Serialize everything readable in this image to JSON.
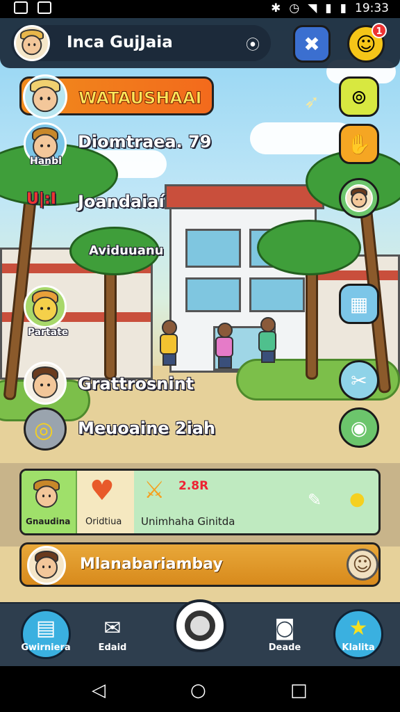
{
  "status_bar": {
    "time": "19:33"
  },
  "header": {
    "player_name": "Inca GujJaia",
    "location_icon": "map-pin-icon",
    "badge_count": "1",
    "colors": {
      "map_button": "#3b6fd0",
      "smile_button": "#f5c518"
    }
  },
  "left_column": {
    "banner": {
      "label": "WATAUSHAAI",
      "color": "#f07a1c"
    },
    "entries": [
      {
        "label": "Diomtraea. 79",
        "caption": "Hanbl"
      },
      {
        "label": "Joandaiaí",
        "prefix": "U|:I"
      },
      {
        "label": "Aviduuanu"
      },
      {
        "label": "",
        "caption": "Partate"
      },
      {
        "label": "Grattrosnint"
      },
      {
        "label": "Meuoaine 2iah"
      }
    ]
  },
  "right_buttons": [
    {
      "icon": "lollipop-icon",
      "color": "#d8e840"
    },
    {
      "icon": "hand-icon",
      "color": "#f5a623"
    },
    {
      "icon": "character-icon",
      "color": "#6cc56c"
    },
    {
      "icon": "calculator-icon",
      "color": "#7cc6e8"
    },
    {
      "icon": "tools-icon",
      "color": "#8fd3e8"
    },
    {
      "icon": "egg-icon",
      "color": "#6cc56c"
    }
  ],
  "quest_panel": {
    "char_label": "Gnaudina",
    "item_label": "Oridtiua",
    "score": "2.8R",
    "description": "Unimhaha Ginitda"
  },
  "message_bar": {
    "text": "Mlanabariambay"
  },
  "bottom_nav": [
    {
      "label": "Gwirniera",
      "icon": "document-icon"
    },
    {
      "label": "Edaid",
      "icon": "envelope-icon"
    },
    {
      "label": "Deade",
      "icon": "vr-headset-icon"
    },
    {
      "label": "Klalita",
      "icon": "star-icon"
    }
  ]
}
